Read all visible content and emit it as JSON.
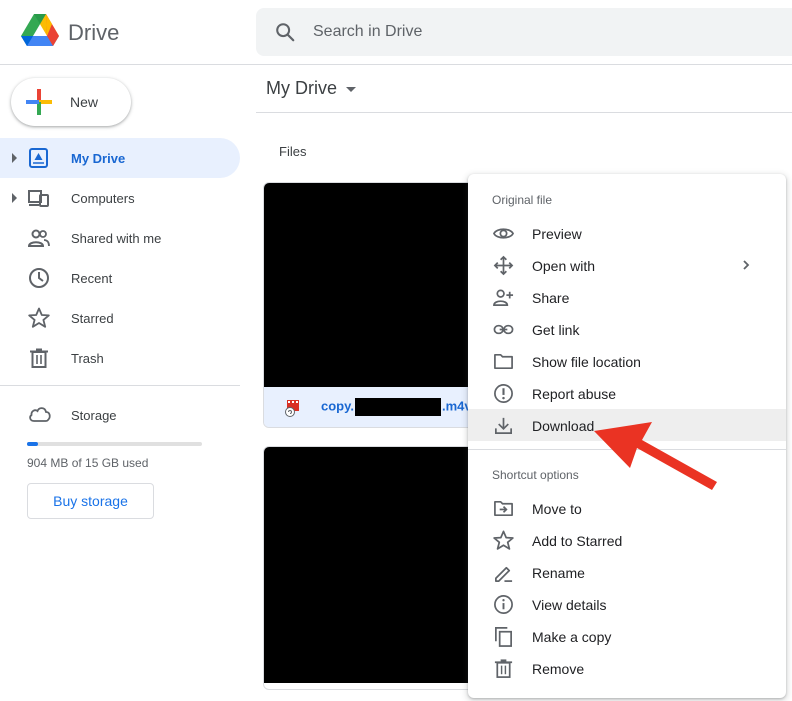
{
  "app": {
    "brand": "Drive",
    "search_placeholder": "Search in Drive"
  },
  "sidebar": {
    "new_label": "New",
    "items": [
      {
        "label": "My Drive",
        "icon": "my-drive-icon",
        "active": true
      },
      {
        "label": "Computers",
        "icon": "computers-icon"
      },
      {
        "label": "Shared with me",
        "icon": "shared-icon"
      },
      {
        "label": "Recent",
        "icon": "clock-icon"
      },
      {
        "label": "Starred",
        "icon": "star-icon"
      },
      {
        "label": "Trash",
        "icon": "trash-icon"
      }
    ],
    "storage": {
      "label": "Storage",
      "used_text": "904 MB of 15 GB used",
      "used_fraction": 0.06,
      "buy_label": "Buy storage"
    }
  },
  "main": {
    "breadcrumb": "My Drive",
    "files_label": "Files",
    "files": [
      {
        "name_prefix": "copy.",
        "name_suffix": ".m4v"
      }
    ]
  },
  "context_menu": {
    "section1": "Original file",
    "section2": "Shortcut options",
    "items1": [
      {
        "label": "Preview",
        "icon": "eye-icon"
      },
      {
        "label": "Open with",
        "icon": "open-with-icon",
        "submenu": true
      },
      {
        "label": "Share",
        "icon": "person-add-icon"
      },
      {
        "label": "Get link",
        "icon": "link-icon"
      },
      {
        "label": "Show file location",
        "icon": "folder-icon"
      },
      {
        "label": "Report abuse",
        "icon": "report-icon"
      },
      {
        "label": "Download",
        "icon": "download-icon",
        "highlighted": true
      }
    ],
    "items2": [
      {
        "label": "Move to",
        "icon": "move-to-icon"
      },
      {
        "label": "Add to Starred",
        "icon": "star-outline-icon"
      },
      {
        "label": "Rename",
        "icon": "pencil-icon"
      },
      {
        "label": "View details",
        "icon": "info-icon"
      },
      {
        "label": "Make a copy",
        "icon": "copy-icon"
      },
      {
        "label": "Remove",
        "icon": "trash-icon"
      }
    ]
  },
  "colors": {
    "accent": "#1a73e8",
    "active_bg": "#e8f0fe",
    "annotation_arrow": "#ea3323"
  }
}
